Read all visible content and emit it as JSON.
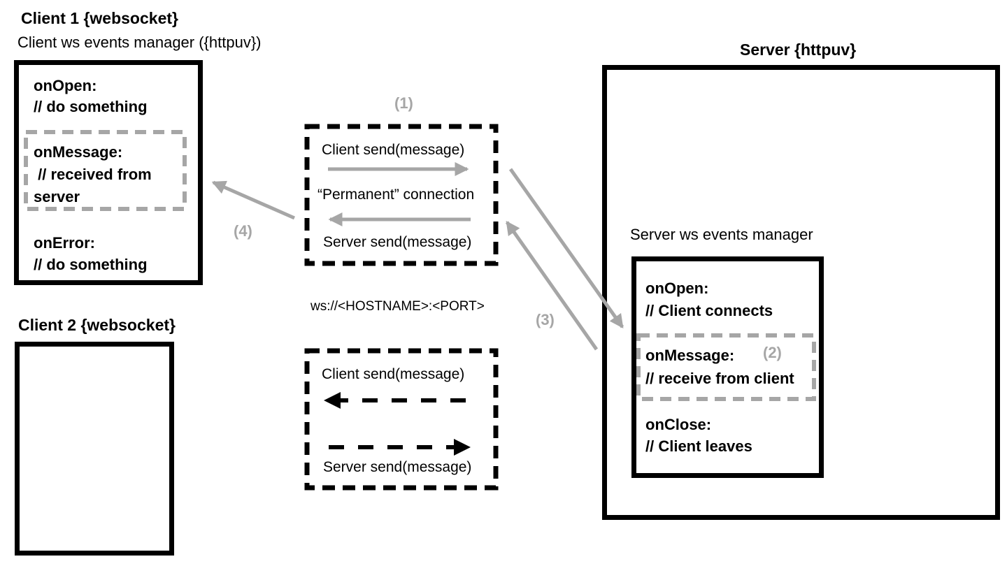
{
  "client1": {
    "title": "Client 1 {websocket}",
    "manager_label": "Client ws events manager ({httpuv})",
    "on_open": "onOpen:",
    "on_open_comment": "// do something",
    "on_message": "onMessage:",
    "on_message_comment_1": " // received from",
    "on_message_comment_2": "server",
    "on_error": "onError:",
    "on_error_comment": "// do something"
  },
  "client2": {
    "title": "Client 2 {websocket}"
  },
  "connection": {
    "step_label": "(1)",
    "client_send": "Client send(message)",
    "permanent": "“Permanent” connection",
    "server_send": "Server send(message)",
    "url": "ws://<HOSTNAME>:<PORT>",
    "client2_client_send": "Client send(message)",
    "client2_server_send": "Server send(message)"
  },
  "server": {
    "title": "Server {httpuv}",
    "manager_label": "Server ws events manager",
    "on_open": "onOpen:",
    "on_open_comment": "// Client connects",
    "on_message": "onMessage:",
    "on_message_step": "(2)",
    "on_message_comment": "// receive from client",
    "on_close": "onClose:",
    "on_close_comment": "// Client leaves"
  },
  "steps": {
    "step3": "(3)",
    "step4": "(4)"
  },
  "colors": {
    "flow_gray": "#a6a6a6",
    "border_black": "#000000"
  }
}
